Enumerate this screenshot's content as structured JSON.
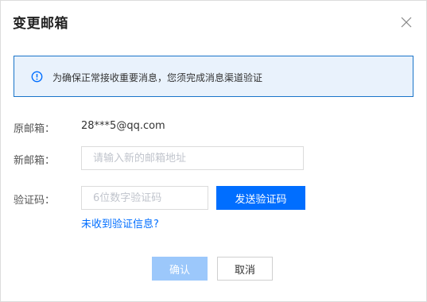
{
  "dialog": {
    "title": "变更邮箱",
    "close_icon": "close-icon"
  },
  "notice": {
    "icon": "info-icon",
    "text": "为确保正常接收重要消息，您须完成消息渠道验证"
  },
  "form": {
    "original_email_label": "原邮箱：",
    "original_email_value": "28***5@qq.com",
    "new_email_label": "新邮箱：",
    "new_email_placeholder": "请输入新的邮箱地址",
    "code_label": "验证码：",
    "code_placeholder": "6位数字验证码",
    "send_code_label": "发送验证码",
    "not_received_link": "未收到验证信息?"
  },
  "footer": {
    "confirm_label": "确认",
    "cancel_label": "取消"
  },
  "colors": {
    "primary": "#006eff",
    "primary_disabled": "#9cc8fb",
    "notice_bg": "#e9f2fc",
    "notice_border": "#1a74c9"
  }
}
